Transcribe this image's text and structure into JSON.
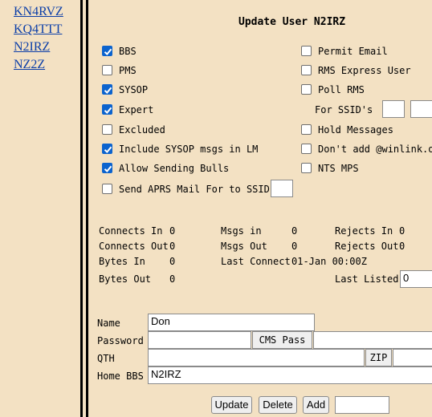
{
  "callsigns": [
    "KN4RVZ",
    "KQ4TTT",
    "N2IRZ",
    "NZ2Z"
  ],
  "title": "Update User N2IRZ",
  "left_options": [
    {
      "label": "BBS",
      "checked": true
    },
    {
      "label": "PMS",
      "checked": false
    },
    {
      "label": "SYSOP",
      "checked": true
    },
    {
      "label": "Expert",
      "checked": true
    },
    {
      "label": "Excluded",
      "checked": false
    },
    {
      "label": "Include SYSOP msgs in LM",
      "checked": true
    },
    {
      "label": "Allow Sending Bulls",
      "checked": true
    },
    {
      "label": "Send APRS Mail For to SSID",
      "checked": false
    }
  ],
  "right_options": [
    {
      "label": "Permit Email",
      "checked": false
    },
    {
      "label": "RMS Express User",
      "checked": false
    },
    {
      "label": "Poll RMS",
      "checked": false
    },
    {
      "label": "Hold Messages",
      "checked": false
    },
    {
      "label": "Don't add @winlink.org",
      "checked": false
    },
    {
      "label": "NTS MPS",
      "checked": false
    }
  ],
  "ssid_label": "For SSID's",
  "stats": {
    "connects_in_label": "Connects In",
    "connects_in": "0",
    "connects_out_label": "Connects Out",
    "connects_out": "0",
    "bytes_in_label": "Bytes In",
    "bytes_in": "0",
    "bytes_out_label": "Bytes Out",
    "bytes_out": "0",
    "msgs_in_label": "Msgs in",
    "msgs_in": "0",
    "msgs_out_label": "Msgs Out",
    "msgs_out": "0",
    "last_connect_label": "Last Connect",
    "last_connect": "01-Jan 00:00Z",
    "rejects_in_label": "Rejects In",
    "rejects_in": "0",
    "rejects_out_label": "Rejects Out",
    "rejects_out": "0",
    "last_listed_label": "Last Listed",
    "last_listed": "0"
  },
  "form": {
    "name_label": "Name",
    "name": "Don",
    "password_label": "Password",
    "password": "",
    "cms_pass_label": "CMS Pass",
    "cms_pass": "",
    "qth_label": "QTH",
    "qth": "",
    "zip_label": "ZIP",
    "zip": "",
    "home_bbs_label": "Home BBS",
    "home_bbs": "N2IRZ"
  },
  "buttons": {
    "update": "Update",
    "delete": "Delete",
    "add": "Add"
  },
  "add_value": "",
  "colors": {
    "background": "#f3e1c3",
    "link": "#0b3ea8",
    "checkbox_accent": "#0b63ce"
  }
}
